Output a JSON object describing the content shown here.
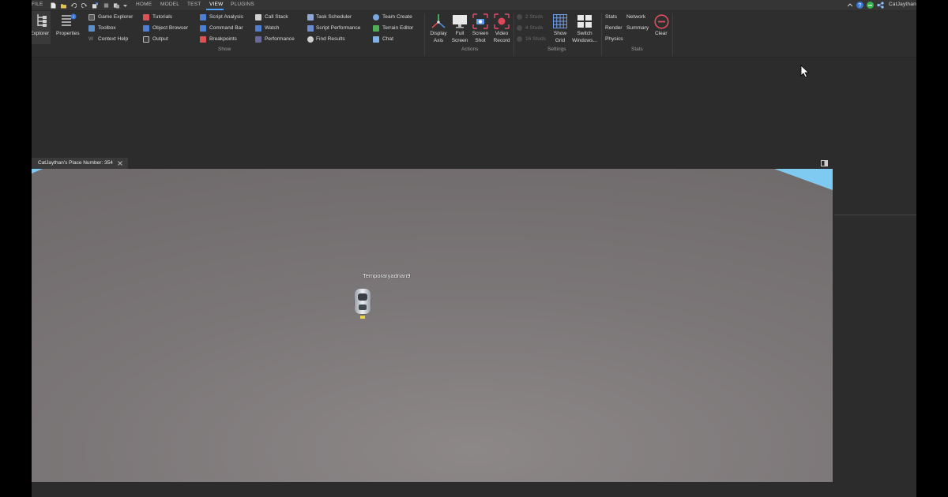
{
  "menubar": {
    "menus": [
      "FILE",
      "HOME",
      "MODEL",
      "TEST",
      "VIEW",
      "PLUGINS"
    ],
    "active_menu": "VIEW",
    "user": "CatJaythan"
  },
  "ribbon": {
    "explorer_label": "Explorer",
    "properties_label": "Properties",
    "show": {
      "group_label": "Show",
      "col1": [
        "Game Explorer",
        "Toolbox",
        "Context Help"
      ],
      "col2": [
        "Tutorials",
        "Object Browser",
        "Output"
      ],
      "col3": [
        "Script Analysis",
        "Command Bar",
        "Breakpoints"
      ],
      "col4": [
        "Call Stack",
        "Watch",
        "Performance"
      ],
      "col5": [
        "Task Scheduler",
        "Script Performance",
        "Find Results"
      ],
      "col6": [
        "Team Create",
        "Terrain Editor",
        "Chat"
      ]
    },
    "actions": {
      "group_label": "Actions",
      "display_axis": [
        "Display",
        "Axis"
      ],
      "full_screen": [
        "Full",
        "Screen"
      ],
      "screen_shot": [
        "Screen",
        "Shot"
      ],
      "video_record": [
        "Video",
        "Record"
      ]
    },
    "settings": {
      "group_label": "Settings",
      "studs": [
        "2 Studs",
        "4 Studs",
        "16 Studs"
      ],
      "show_grid": [
        "Show",
        "Grid"
      ],
      "switch_windows": [
        "Switch",
        "Windows..."
      ]
    },
    "stats": {
      "group_label": "Stats",
      "items": [
        "Stats",
        "Network",
        "Render",
        "Summary",
        "Physics"
      ],
      "clear_label": "Clear"
    }
  },
  "viewport": {
    "tab_label": "CatJaythan's Place Number: 354",
    "player_name": "Temporaryadrian9"
  },
  "colors": {
    "accent": "#4aa3ff",
    "ground": "#7b7677",
    "sky": "#7ecaf0",
    "record_red": "#e0455a"
  }
}
